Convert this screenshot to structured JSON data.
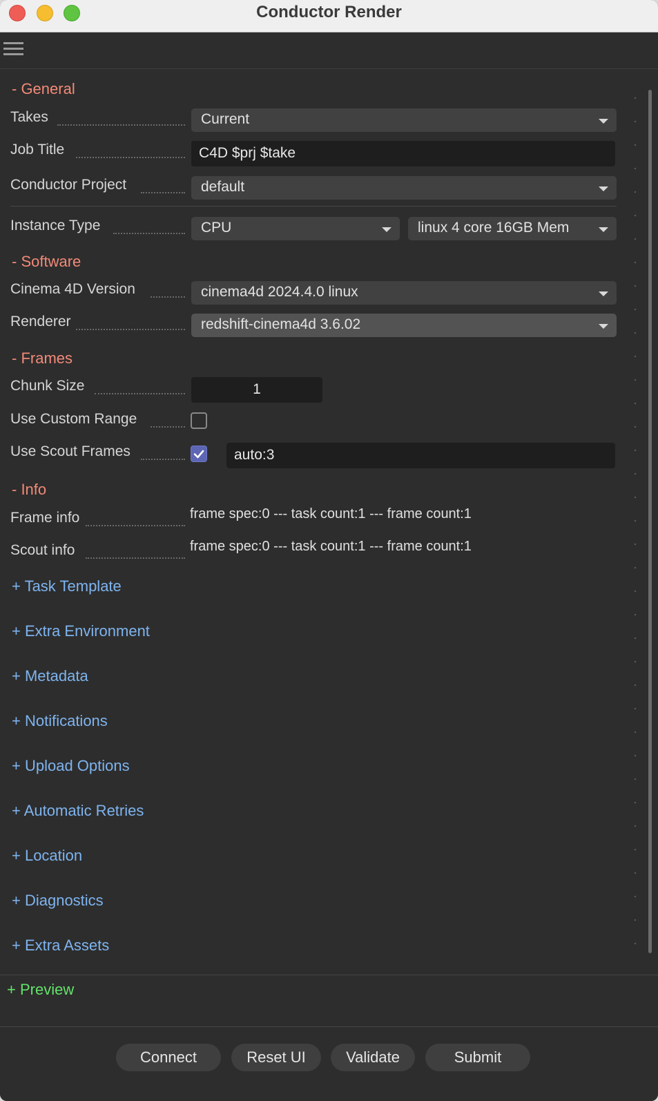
{
  "window": {
    "title": "Conductor Render"
  },
  "sections": {
    "general": {
      "header": "- General"
    },
    "software": {
      "header": "- Software"
    },
    "frames": {
      "header": "- Frames"
    },
    "info": {
      "header": "- Info"
    }
  },
  "general": {
    "takes": {
      "label": "Takes",
      "value": "Current"
    },
    "job_title": {
      "label": "Job Title",
      "value": "C4D $prj $take"
    },
    "project": {
      "label": "Conductor Project",
      "value": "default"
    },
    "instance_type": {
      "label": "Instance Type",
      "value": "CPU",
      "machine": "linux 4 core 16GB Mem"
    }
  },
  "software": {
    "c4d_version": {
      "label": "Cinema 4D Version",
      "value": "cinema4d 2024.4.0 linux"
    },
    "renderer": {
      "label": "Renderer",
      "value": "redshift-cinema4d 3.6.02"
    }
  },
  "frames": {
    "chunk_size": {
      "label": "Chunk Size",
      "value": "1"
    },
    "custom_range": {
      "label": "Use Custom Range",
      "checked": false
    },
    "scout_frames": {
      "label": "Use Scout Frames",
      "checked": true,
      "value": "auto:3"
    }
  },
  "info": {
    "frame_info": {
      "label": "Frame info",
      "value": "frame spec:0 --- task count:1 --- frame count:1"
    },
    "scout_info": {
      "label": "Scout info",
      "value": "frame spec:0 --- task count:1 --- frame count:1"
    }
  },
  "collapsed_sections": [
    "+ Task Template",
    "+ Extra Environment",
    "+ Metadata",
    "+ Notifications",
    "+ Upload Options",
    "+ Automatic Retries",
    "+ Location",
    "+ Diagnostics",
    "+ Extra Assets"
  ],
  "preview": {
    "label": "+ Preview"
  },
  "buttons": {
    "connect": "Connect",
    "reset": "Reset UI",
    "validate": "Validate",
    "submit": "Submit"
  },
  "colors": {
    "open_section": "#f28a78",
    "closed_section": "#7eb4ef",
    "preview": "#63e26a",
    "checkbox_on": "#5d65b5"
  }
}
